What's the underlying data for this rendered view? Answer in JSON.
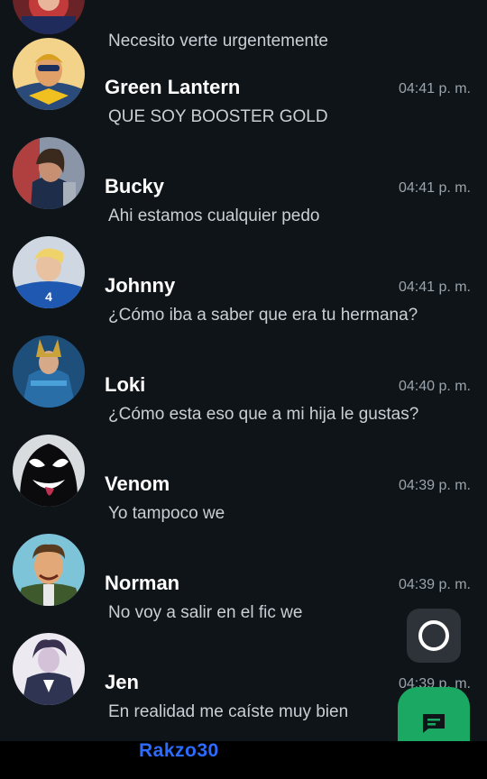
{
  "chats": [
    {
      "name": "",
      "preview": "Necesito verte urgentemente",
      "time": "",
      "avatar_icon": "red-character-avatar-icon"
    },
    {
      "name": "Green Lantern",
      "preview": "QUE SOY BOOSTER GOLD",
      "time": "04:41 p. m.",
      "avatar_icon": "booster-gold-avatar-icon"
    },
    {
      "name": "Bucky",
      "preview": "Ahi estamos cualquier pedo",
      "time": "04:41 p. m.",
      "avatar_icon": "bucky-avatar-icon"
    },
    {
      "name": "Johnny",
      "preview": "¿Cómo iba a saber que era tu hermana?",
      "time": "04:41 p. m.",
      "avatar_icon": "johnny-avatar-icon"
    },
    {
      "name": "Loki",
      "preview": "¿Cómo esta eso que a mi hija le gustas?",
      "time": "04:40 p. m.",
      "avatar_icon": "loki-avatar-icon"
    },
    {
      "name": "Venom",
      "preview": "Yo tampoco we",
      "time": "04:39 p. m.",
      "avatar_icon": "venom-avatar-icon"
    },
    {
      "name": "Norman",
      "preview": "No voy a salir en el fic we",
      "time": "04:39 p. m.",
      "avatar_icon": "norman-avatar-icon"
    },
    {
      "name": "Jen",
      "preview": "En realidad me caíste muy bien",
      "time": "04:39 p. m.",
      "avatar_icon": "jen-avatar-icon"
    }
  ],
  "watermark": "Rakzo30",
  "floating_button_icon": "ring-icon",
  "compose_button_icon": "message-icon",
  "colors": {
    "background": "#0f1419",
    "accent": "#1ba862",
    "watermark": "#2d6bff",
    "time_text": "#9aa4ac",
    "preview_text": "#c9cfd4"
  }
}
